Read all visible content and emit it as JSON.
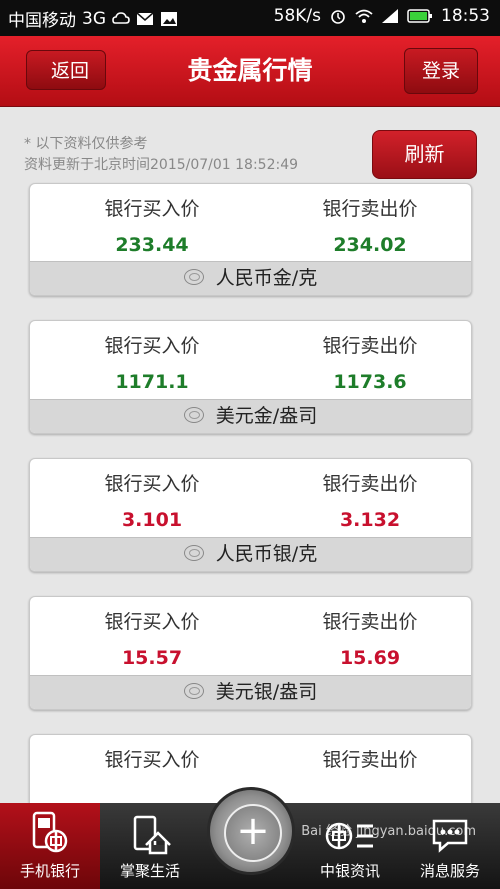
{
  "statusbar": {
    "carrier": "中国移动",
    "network": "3G",
    "speed": "58K/s",
    "time": "18:53"
  },
  "header": {
    "back_label": "返回",
    "title": "贵金属行情",
    "login_label": "登录"
  },
  "notes": {
    "disclaimer": "* 以下资料仅供参考",
    "updated": "资料更新于北京时间2015/07/01 18:52:49",
    "refresh_label": "刷新"
  },
  "cards": [
    {
      "buy_label": "银行买入价",
      "sell_label": "银行卖出价",
      "buy": "233.44",
      "sell": "234.02",
      "name": "人民币金/克",
      "color": "#1e7d2a"
    },
    {
      "buy_label": "银行买入价",
      "sell_label": "银行卖出价",
      "buy": "1171.1",
      "sell": "1173.6",
      "name": "美元金/盎司",
      "color": "#1e7d2a"
    },
    {
      "buy_label": "银行买入价",
      "sell_label": "银行卖出价",
      "buy": "3.101",
      "sell": "3.132",
      "name": "人民币银/克",
      "color": "#c8102e"
    },
    {
      "buy_label": "银行买入价",
      "sell_label": "银行卖出价",
      "buy": "15.57",
      "sell": "15.69",
      "name": "美元银/盎司",
      "color": "#c8102e"
    },
    {
      "buy_label": "银行买入价",
      "sell_label": "银行卖出价"
    }
  ],
  "nav": [
    {
      "label": "手机银行",
      "icon": "phone-bank-icon",
      "active": true
    },
    {
      "label": "掌聚生活",
      "icon": "home-icon",
      "active": false
    },
    {
      "label": "中银资讯",
      "icon": "boc-news-icon",
      "active": false
    },
    {
      "label": "消息服务",
      "icon": "message-icon",
      "active": false
    }
  ],
  "center_button": {
    "label": "+"
  },
  "watermark": "Bai 经验 jingyan.baidu.com"
}
